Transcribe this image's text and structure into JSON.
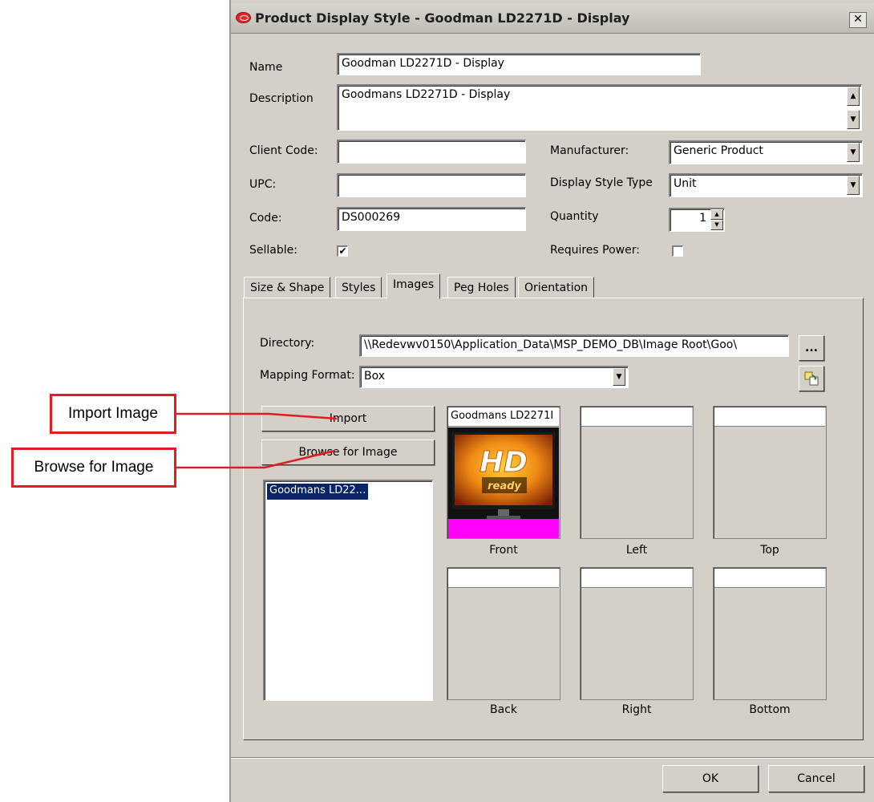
{
  "window": {
    "title": "Product Display Style - Goodman LD2271D - Display",
    "close_glyph": "✕"
  },
  "form": {
    "name_label": "Name",
    "name_value": "Goodman LD2271D - Display",
    "description_label": "Description",
    "description_value": "Goodmans LD2271D  - Display",
    "client_code_label": "Client Code:",
    "client_code_value": "",
    "upc_label": "UPC:",
    "upc_value": "",
    "code_label": "Code:",
    "code_value": "DS000269",
    "sellable_label": "Sellable:",
    "sellable_checked": true,
    "manufacturer_label": "Manufacturer:",
    "manufacturer_value": "Generic Product",
    "display_style_type_label": "Display Style Type",
    "display_style_type_value": "Unit",
    "quantity_label": "Quantity",
    "quantity_value": "1",
    "requires_power_label": "Requires Power:",
    "requires_power_checked": false
  },
  "tabs": [
    {
      "label": "Size & Shape",
      "active": false
    },
    {
      "label": "Styles",
      "active": false
    },
    {
      "label": "Images",
      "active": true
    },
    {
      "label": "Peg Holes",
      "active": false
    },
    {
      "label": "Orientation",
      "active": false
    }
  ],
  "images_tab": {
    "directory_label": "Directory:",
    "directory_value": "\\\\Redevwv0150\\Application_Data\\MSP_DEMO_DB\\Image Root\\Goo\\",
    "browse_dir_label": "...",
    "mapping_format_label": "Mapping Format:",
    "mapping_format_value": "Box",
    "import_button": "Import",
    "browse_image_button": "Browse for Image",
    "image_list": [
      "Goodmans LD22..."
    ],
    "slots": [
      {
        "label": "Front",
        "header": "Goodmans LD2271I",
        "has_image": true
      },
      {
        "label": "Left",
        "header": "",
        "has_image": false
      },
      {
        "label": "Top",
        "header": "",
        "has_image": false
      },
      {
        "label": "Back",
        "header": "",
        "has_image": false
      },
      {
        "label": "Right",
        "header": "",
        "has_image": false
      },
      {
        "label": "Bottom",
        "header": "",
        "has_image": false
      }
    ],
    "thumbnail": {
      "big_text": "HD",
      "sub_text": "ready"
    }
  },
  "footer": {
    "ok_label": "OK",
    "cancel_label": "Cancel"
  },
  "callouts": {
    "import_image": "Import Image",
    "browse_for_image": "Browse for Image"
  },
  "colors": {
    "dialog_bg": "#d4d0c8",
    "callout_border": "#e31b23",
    "selection": "#0a246a",
    "thumbnail_magenta": "#ff00ff"
  }
}
